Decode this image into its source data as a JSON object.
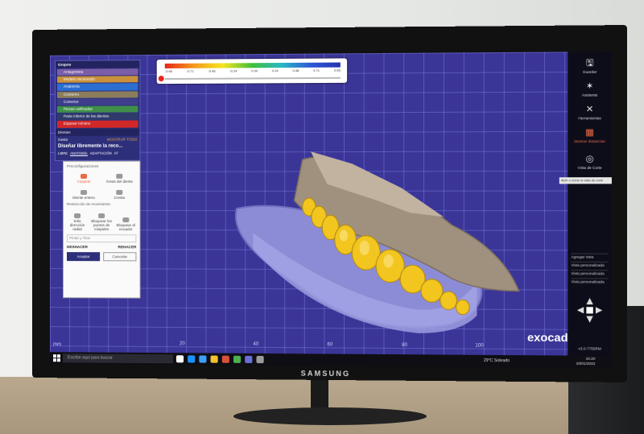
{
  "monitor": {
    "brand": "SAMSUNG"
  },
  "colorbar": {
    "ticks": [
      "-0.95",
      "-0.71",
      "-0.48",
      "-0.24",
      "0.00",
      "0.24",
      "0.48",
      "0.71",
      "0.95"
    ]
  },
  "left_panel": {
    "groups_header": "Grupos",
    "groups": [
      {
        "label": "Antagonista",
        "color": "#7b5ea8"
      },
      {
        "label": "Modelo escaneado",
        "color": "#c9913a"
      },
      {
        "label": "Anatomía",
        "color": "#2a6fd1"
      },
      {
        "label": "Contorno",
        "color": "#8b7d5c"
      },
      {
        "label": "Conector",
        "color": "#3e3e8c"
      },
      {
        "label": "Piezas unificadas",
        "color": "#3f8f4a"
      },
      {
        "label": "Parte inferior de los dientes",
        "color": "#2e3b6a"
      },
      {
        "label": "Espesor mínimo",
        "color": "#d12828"
      }
    ],
    "teeth_header": "Dientes",
    "gesture_label": "Gesto",
    "show_all": "MOSTRAR TODO",
    "design_title": "Diseñar libremente la reco...",
    "tabs": [
      "LIBRE",
      "ANATOMÍA",
      "ADAPTACIÓN",
      "AT"
    ],
    "active_tab": "ANATOMÍA"
  },
  "tool_card": {
    "presets_label": "Preconfiguraciones",
    "presets": [
      "Cúspide",
      "Áreas del diente",
      "Diente entero",
      "Cresta"
    ],
    "restriction_label": "Restricción de movimiento",
    "restrictions": [
      "Sólo dirección radial",
      "Bloquear los puntos de cúspides",
      "Bloquear el ecuador"
    ],
    "dropdown": "Pintar y Tirar",
    "undo": "DESHACER",
    "redo": "REHACER",
    "accept": "Aceptar",
    "cancel": "Cancelar"
  },
  "toolbar": {
    "items": [
      {
        "label": "Guardar",
        "icon": "save-icon",
        "glyph": "🖫"
      },
      {
        "label": "Asistente",
        "icon": "wand-icon",
        "glyph": "✶"
      },
      {
        "label": "Herramientas",
        "icon": "tools-icon",
        "glyph": "✕"
      },
      {
        "label": "Mostrar distancias",
        "icon": "distance-icon",
        "glyph": "▦"
      },
      {
        "label": "Vista de Corte",
        "icon": "cut-view-icon",
        "glyph": "◎"
      }
    ],
    "tooltip": "Abrir o cerrar la vista de corte",
    "view_links": [
      "Agregar vista",
      "Vista personalizada",
      "Vista personalizada",
      "Vista personalizada"
    ],
    "version": "v3.0-7755RM"
  },
  "viewport": {
    "logo": "exocad",
    "unit": "mm",
    "ruler": [
      "20",
      "40",
      "60",
      "80",
      "100"
    ]
  },
  "taskbar": {
    "search_placeholder": "Escribe aquí para buscar",
    "weather": "29°C  Soleado",
    "time": "16:20",
    "date": "20/01/2022",
    "app_colors": [
      "#ffffff",
      "#1e90ff",
      "#3aa0ff",
      "#f2c230",
      "#d94f3b",
      "#4caf50",
      "#6d6dd8",
      "#9b9b9b"
    ]
  },
  "colors": {
    "viewport": "#3a3597",
    "accent": "#e86a45",
    "teeth": "#f2c51f",
    "gingiva": "#9a8878",
    "lower_arch": "#8c8cd6"
  }
}
